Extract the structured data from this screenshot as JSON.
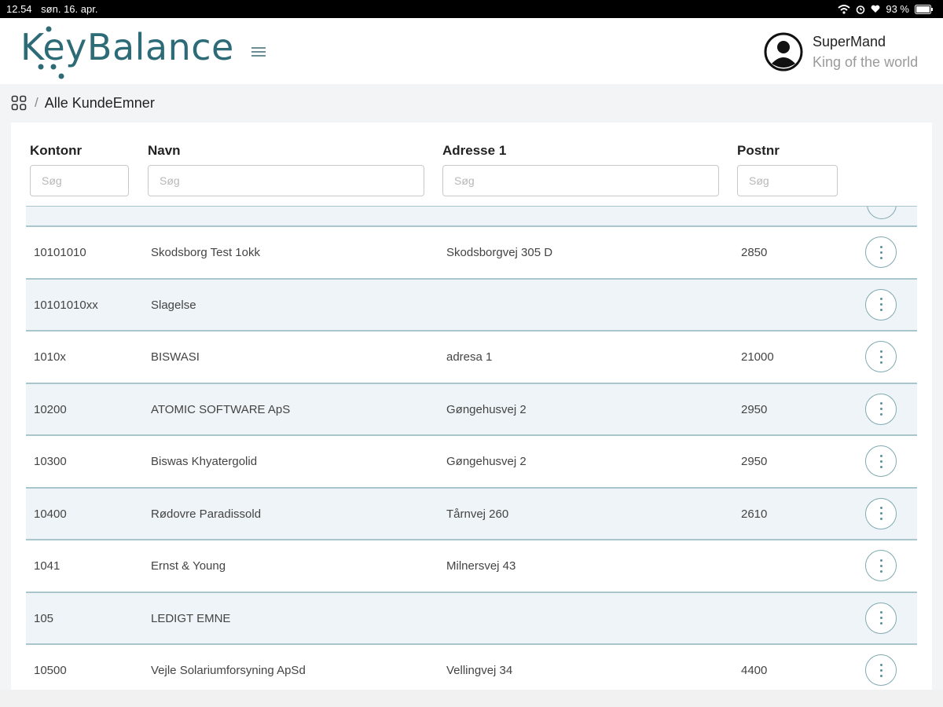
{
  "statusbar": {
    "time": "12.54",
    "date": "søn. 16. apr.",
    "battery": "93 %"
  },
  "header": {
    "logo": "KeyBalance",
    "user_name": "SuperMand",
    "user_subtitle": "King of the world"
  },
  "breadcrumb": {
    "separator": "/",
    "label": "Alle KundeEmner"
  },
  "filters": [
    {
      "label": "Kontonr",
      "placeholder": "Søg"
    },
    {
      "label": "Navn",
      "placeholder": "Søg"
    },
    {
      "label": "Adresse 1",
      "placeholder": "Søg"
    },
    {
      "label": "Postnr",
      "placeholder": "Søg"
    }
  ],
  "rows": [
    {
      "kontonr": "10101010",
      "navn": "Skodsborg Test 1okk",
      "adresse": "Skodsborgvej 305 D",
      "postnr": "2850"
    },
    {
      "kontonr": "10101010xx",
      "navn": "Slagelse",
      "adresse": "",
      "postnr": ""
    },
    {
      "kontonr": "1010x",
      "navn": "BISWASI",
      "adresse": "adresa 1",
      "postnr": "21000"
    },
    {
      "kontonr": "10200",
      "navn": "ATOMIC SOFTWARE ApS",
      "adresse": "Gøngehusvej 2",
      "postnr": "2950"
    },
    {
      "kontonr": "10300",
      "navn": "Biswas Khyatergolid",
      "adresse": "Gøngehusvej 2",
      "postnr": "2950"
    },
    {
      "kontonr": "10400",
      "navn": "Rødovre Paradissold",
      "adresse": "Tårnvej 260",
      "postnr": "2610"
    },
    {
      "kontonr": "1041",
      "navn": "Ernst & Young",
      "adresse": "Milnersvej 43",
      "postnr": ""
    },
    {
      "kontonr": "105",
      "navn": "LEDIGT EMNE",
      "adresse": "",
      "postnr": ""
    },
    {
      "kontonr": "10500",
      "navn": "Vejle Solariumforsyning ApSd",
      "adresse": "Vellingvej 34",
      "postnr": "4400"
    }
  ],
  "colors": {
    "brand": "#2d6b76",
    "row_alt": "#eef4f7",
    "row_border": "#a9c6cd"
  }
}
